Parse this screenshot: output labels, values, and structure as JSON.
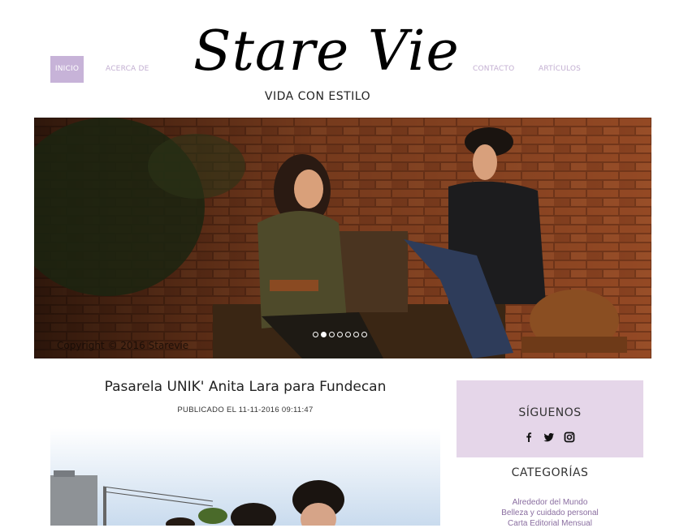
{
  "nav": {
    "home": "INICIO",
    "about": "ACERCA DE",
    "contact": "CONTACTO",
    "articles": "ARTÍCULOS"
  },
  "brand": {
    "logo": "Stare Vie",
    "tagline": "VIDA CON ESTILO"
  },
  "slider": {
    "copyright": "Copyright © 2016 Starevie",
    "slide_count": 7,
    "active_slide": 2
  },
  "post": {
    "title": "Pasarela UNIK' Anita Lara para Fundecan",
    "meta": "PUBLICADO EL 11-11-2016 09:11:47"
  },
  "sidebar": {
    "follow_title": "SÍGUENOS",
    "social_icons": [
      "facebook-icon",
      "twitter-icon",
      "instagram-icon"
    ],
    "categories_title": "CATEGORÍAS",
    "categories": [
      "Alrededor del Mundo",
      "Belleza y cuidado personal",
      "Carta Editorial Mensual"
    ]
  },
  "colors": {
    "accent": "#c7b3d8",
    "sidebar_bg": "#e5d6e9",
    "link": "#8a6ea0"
  }
}
